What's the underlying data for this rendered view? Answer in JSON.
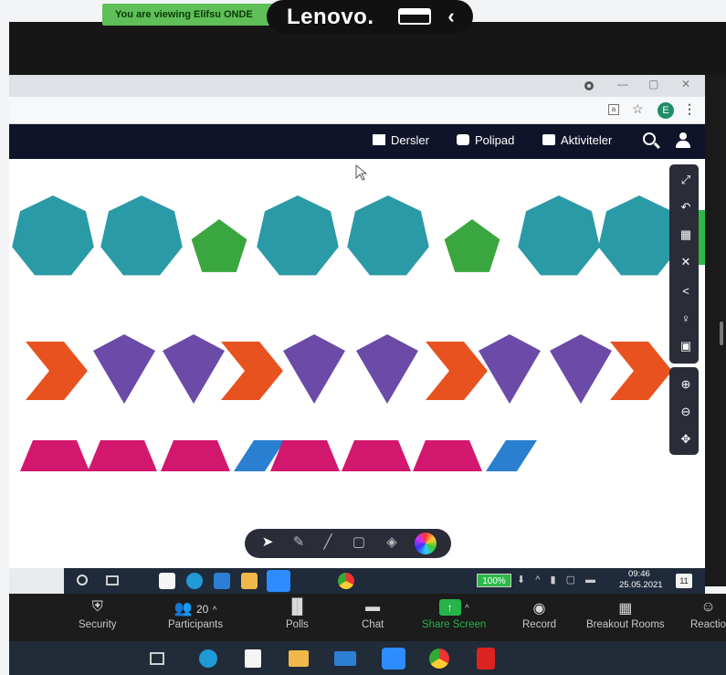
{
  "zoom_banner": "You are viewing Elifsu ONDE",
  "device_brand": "Lenovo.",
  "window_controls": {
    "minimize": "—",
    "restore": "▢",
    "close": "✕"
  },
  "profile_initial": "E",
  "nav": {
    "lessons": "Dersler",
    "polipad": "Polipad",
    "activities": "Aktiviteler"
  },
  "shapes": {
    "row1": [
      "heptagon",
      "heptagon",
      "pentagon",
      "heptagon",
      "heptagon",
      "pentagon",
      "heptagon",
      "heptagon"
    ],
    "row2": [
      "chevron",
      "kite",
      "kite",
      "chevron",
      "kite",
      "kite",
      "chevron",
      "kite",
      "kite",
      "chevron"
    ],
    "row3": [
      "trapezoid",
      "trapezoid",
      "trapezoid",
      "parallelogram",
      "trapezoid",
      "trapezoid",
      "trapezoid",
      "parallelogram"
    ],
    "colors": {
      "heptagon": "#2a9aa6",
      "pentagon": "#3aa63f",
      "chevron": "#e8521f",
      "kite": "#6b4aa8",
      "trapezoid": "#d2186e",
      "parallelogram": "#2a7fd0"
    }
  },
  "windows_taskbar": {
    "battery": "100%",
    "time": "09:46",
    "date": "25.05.2021",
    "notifications": "11"
  },
  "zoom_toolbar": {
    "security": "Security",
    "participants": "Participants",
    "participants_count": "20",
    "polls": "Polls",
    "chat": "Chat",
    "share_screen": "Share Screen",
    "record": "Record",
    "breakout_rooms": "Breakout Rooms",
    "reactions": "Reactio"
  },
  "colors": {
    "accent_green": "#2db84a",
    "nav_bg": "#10142a",
    "share_green": "#25b34a"
  }
}
